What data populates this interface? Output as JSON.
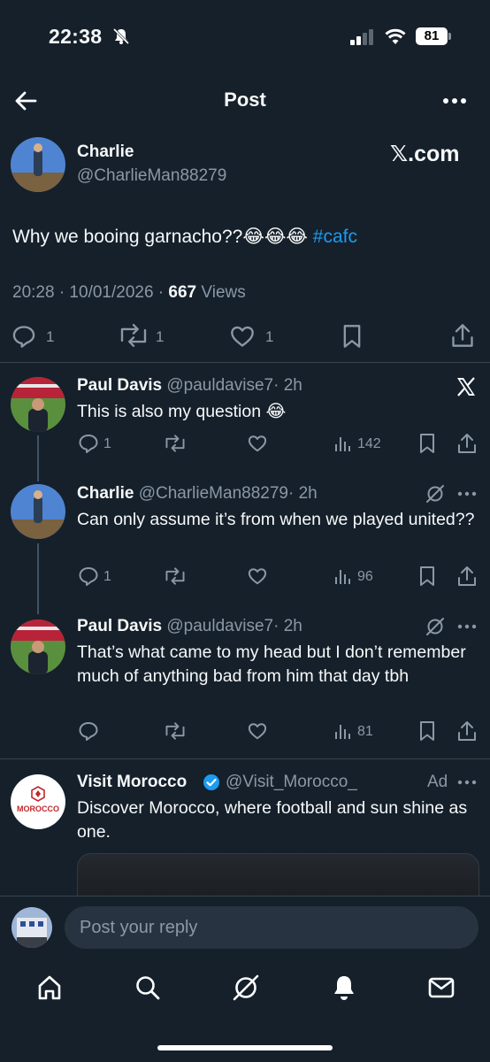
{
  "status_bar": {
    "time": "22:38",
    "battery": "81"
  },
  "header": {
    "title": "Post"
  },
  "main_post": {
    "name": "Charlie",
    "handle": "@CharlieMan88279",
    "watermark": "𝕏.com",
    "text": "Why we booing garnacho??😂😂😂",
    "hashtag": "#cafc",
    "timestamp": "20:28 · 10/01/2026 ·",
    "views_count": "667",
    "views_label": "Views",
    "replies": "1",
    "reposts": "1",
    "likes": "1"
  },
  "replies": [
    {
      "name": "Paul Davis",
      "handle": "@pauldavise7",
      "time": "· 2h",
      "text": "This is also my question 😂",
      "replies": "1",
      "views": "142"
    },
    {
      "name": "Charlie",
      "handle": "@CharlieMan88279",
      "time": "· 2h",
      "text": "Can only assume it’s from when we played united??",
      "replies": "1",
      "views": "96"
    },
    {
      "name": "Paul Davis",
      "handle": "@pauldavise7",
      "time": "· 2h",
      "text": "That’s what came to my head but I don’t remember much of anything bad from him that day tbh",
      "replies": "",
      "views": "81"
    }
  ],
  "ad": {
    "name": "Visit Morocco",
    "handle": "@Visit_Morocco_",
    "ad_label": "Ad",
    "text": "Discover Morocco, where football and sun shine as one.",
    "logo_text": "MOROCCO"
  },
  "reply_bar": {
    "placeholder": "Post your reply"
  },
  "colors": {
    "background": "#15202b",
    "accent": "#1d9bf0",
    "muted": "#8b98a5",
    "verified": "#1d9bf0"
  },
  "icons": [
    "back-arrow-icon",
    "more-icon",
    "reply-icon",
    "repost-icon",
    "like-icon",
    "bookmark-icon",
    "share-icon",
    "views-icon",
    "grok-icon",
    "x-logo-icon",
    "home-icon",
    "search-icon",
    "notifications-icon",
    "messages-icon"
  ]
}
